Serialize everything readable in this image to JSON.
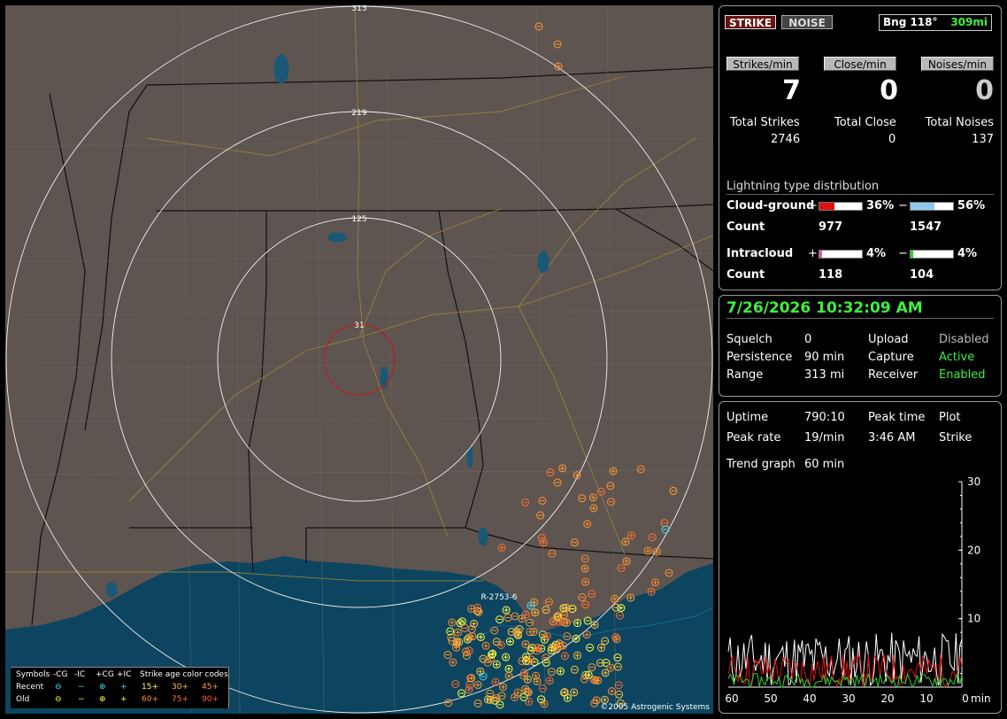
{
  "map": {
    "range_labels": [
      "313",
      "219",
      "125",
      "31"
    ],
    "strike_label": "R-2753-6",
    "copyright": "©2005 Astrogenic Systems",
    "legend": {
      "header": [
        "Symbols",
        "-CG",
        "-IC",
        "+CG",
        "+IC",
        "Strike age color codes"
      ],
      "recent_label": "Recent",
      "old_label": "Old",
      "recent_ages": [
        "15+",
        "30+",
        "45+"
      ],
      "old_ages": [
        "60+",
        "75+",
        "90+"
      ],
      "colors": {
        "cyan": "#40e0f0",
        "yellow": "#ffff40",
        "orange": "#ff9a30"
      }
    }
  },
  "status": {
    "strike_button": "STRIKE",
    "noise_button": "NOISE",
    "bearing": "Bng 118°",
    "bearing_distance": "309mi",
    "strikes_per_min_label": "Strikes/min",
    "close_per_min_label": "Close/min",
    "noises_per_min_label": "Noises/min",
    "strikes_per_min": "7",
    "close_per_min": "0",
    "noises_per_min": "0",
    "total_strikes_label": "Total Strikes",
    "total_close_label": "Total Close",
    "total_noises_label": "Total Noises",
    "total_strikes": "2746",
    "total_close": "0",
    "total_noises": "137"
  },
  "distribution": {
    "title": "Lightning type distribution",
    "cg_label": "Cloud-ground",
    "ic_label": "Intracloud",
    "count_label": "Count",
    "plus": "+",
    "minus": "−",
    "cg_pos_pct": "36%",
    "cg_neg_pct": "56%",
    "ic_pos_pct": "4%",
    "ic_neg_pct": "4%",
    "cg_pos_fill": 0.36,
    "cg_neg_fill": 0.56,
    "ic_pos_fill": 0.04,
    "ic_neg_fill": 0.04,
    "cg_pos_count": "977",
    "cg_neg_count": "1547",
    "ic_pos_count": "118",
    "ic_neg_count": "104"
  },
  "settings": {
    "datetime": "7/26/2026 10:32:09 AM",
    "squelch_label": "Squelch",
    "squelch": "0",
    "persistence_label": "Persistence",
    "persistence": "90 min",
    "range_label": "Range",
    "range": "313 mi",
    "upload_label": "Upload",
    "upload": "Disabled",
    "capture_label": "Capture",
    "capture": "Active",
    "receiver_label": "Receiver",
    "receiver": "Enabled"
  },
  "stats": {
    "uptime_label": "Uptime",
    "uptime": "790:10",
    "peak_time_label": "Peak time",
    "peak_time": "3:46 AM",
    "plot_label": "Plot",
    "plot": "Strike",
    "peak_rate_label": "Peak rate",
    "peak_rate": "19/min",
    "trend_label": "Trend graph",
    "trend": "60 min"
  },
  "chart_data": {
    "type": "line",
    "x_ticks": [
      "60",
      "50",
      "40",
      "30",
      "20",
      "10",
      "0"
    ],
    "x_unit": "min",
    "y_ticks": [
      "30",
      "20",
      "10"
    ],
    "ylim": [
      0,
      30
    ],
    "xlim": [
      60,
      0
    ]
  }
}
